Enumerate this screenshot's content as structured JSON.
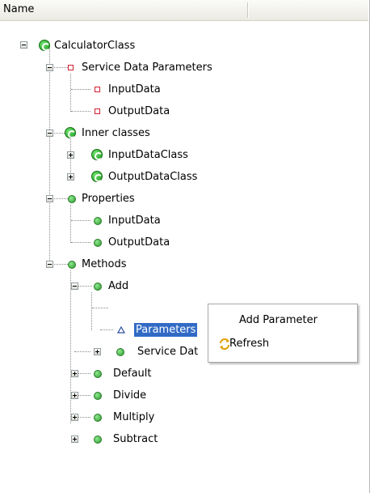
{
  "header": {
    "column_name": "Name"
  },
  "tree": {
    "root": "CalculatorClass",
    "service_data_parameters": "Service Data Parameters",
    "sdp_input": "InputData",
    "sdp_output": "OutputData",
    "inner_classes": "Inner classes",
    "inner_input": "InputDataClass",
    "inner_output": "OutputDataClass",
    "properties": "Properties",
    "prop_input": "InputData",
    "prop_output": "OutputData",
    "methods": "Methods",
    "add": "Add",
    "parameters": "Parameters",
    "service_data": "Service Dat",
    "default": "Default",
    "divide": "Divide",
    "multiply": "Multiply",
    "subtract": "Subtract"
  },
  "context_menu": {
    "add_parameter": "Add Parameter",
    "refresh": "Refresh"
  },
  "colors": {
    "selection": "#316ac5",
    "class_icon": "#2ea02e",
    "member_square": "#d01f2e"
  }
}
